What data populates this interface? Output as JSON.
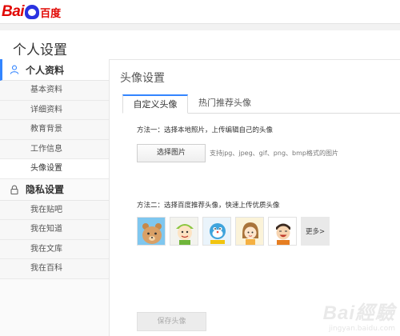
{
  "logo": {
    "bai": "Bai",
    "cn": "百度"
  },
  "page_title": "个人设置",
  "sidebar": {
    "group_profile": "个人资料",
    "profile_items": [
      "基本资料",
      "详细资料",
      "教育背景",
      "工作信息",
      "头像设置"
    ],
    "group_privacy": "隐私设置",
    "privacy_items": [
      "我在贴吧",
      "我在知道",
      "我在文库",
      "我在百科"
    ]
  },
  "content": {
    "title": "头像设置",
    "tabs": [
      "自定义头像",
      "热门推荐头像"
    ],
    "method1": "方法一：选择本地照片，上传编辑自己的头像",
    "choose_button": "选择图片",
    "support_text": "支持jpg、jpeg、gif、png、bmp格式的图片",
    "method2": "方法二：选择百度推荐头像，快速上传优质头像",
    "more_button": "更多>",
    "save_button": "保存头像"
  },
  "watermark": {
    "main": "Bai經驗",
    "sub": "jingyan.baidu.com"
  },
  "colors": {
    "brand_red": "#e10602",
    "brand_blue": "#2932e1",
    "accent": "#3385ff"
  },
  "icons": {
    "profile": "user-icon",
    "privacy": "lock-icon"
  }
}
